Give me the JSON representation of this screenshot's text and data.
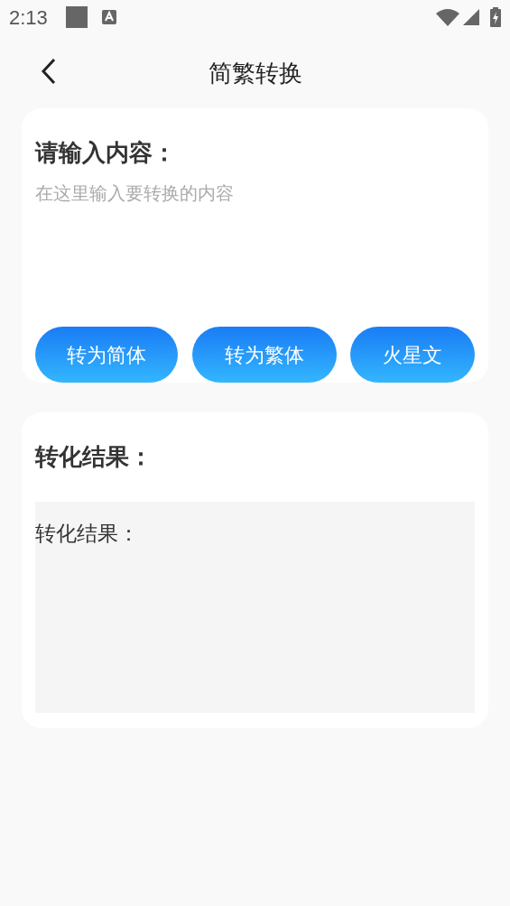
{
  "status_bar": {
    "time": "2:13"
  },
  "header": {
    "title": "简繁转换"
  },
  "input_card": {
    "label": "请输入内容：",
    "placeholder": "在这里输入要转换的内容",
    "buttons": [
      "转为简体",
      "转为繁体",
      "火星文"
    ]
  },
  "result_card": {
    "title": "转化结果：",
    "result": "转化结果："
  }
}
